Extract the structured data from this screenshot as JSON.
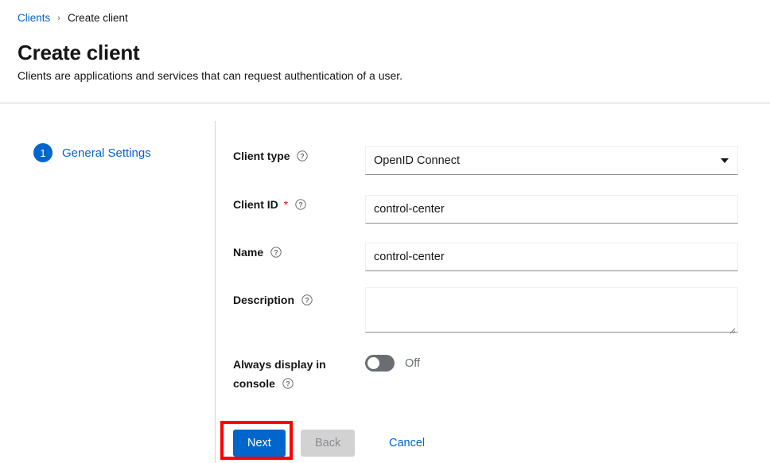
{
  "breadcrumb": {
    "parent": "Clients",
    "separator": "›",
    "current": "Create client"
  },
  "header": {
    "title": "Create client",
    "subtitle": "Clients are applications and services that can request authentication of a user."
  },
  "wizard": {
    "steps": [
      {
        "number": "1",
        "label": "General Settings"
      }
    ]
  },
  "form": {
    "client_type": {
      "label": "Client type",
      "value": "OpenID Connect",
      "help": "help-icon",
      "caret": "chevron-down-icon"
    },
    "client_id": {
      "label": "Client ID",
      "required_marker": "*",
      "value": "control-center",
      "placeholder": "",
      "help": "help-icon"
    },
    "name": {
      "label": "Name",
      "value": "control-center",
      "placeholder": "",
      "help": "help-icon"
    },
    "description": {
      "label": "Description",
      "value": "",
      "placeholder": "",
      "help": "help-icon"
    },
    "always_display": {
      "label": "Always display in console",
      "state_label": "Off",
      "enabled": false,
      "help": "help-icon"
    }
  },
  "footer": {
    "next_label": "Next",
    "back_label": "Back",
    "cancel_label": "Cancel"
  },
  "colors": {
    "accent": "#0066cc",
    "required": "#c9190b",
    "annotation": "#ff0000",
    "toggle_off": "#6a6e73",
    "muted": "#6a6e73",
    "border": "#d2d2d2"
  },
  "annotation": {
    "target": "Next",
    "shape": "rectangle",
    "color": "#ff0000"
  }
}
